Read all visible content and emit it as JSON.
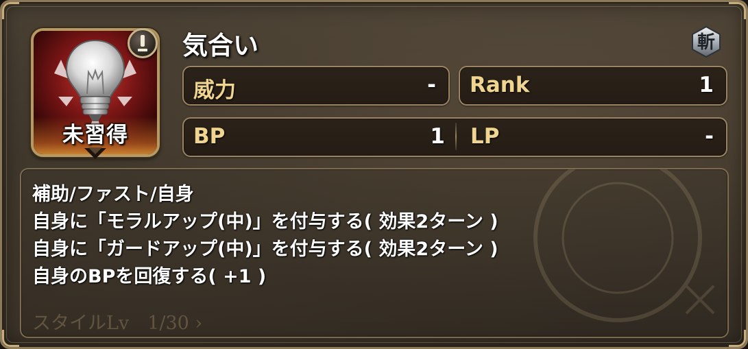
{
  "skill": {
    "name": "気合い",
    "status_label": "未習得",
    "type_badge_glyph": "斬",
    "icon": "lightbulb-icon",
    "alert_icon": "exclamation-icon"
  },
  "stats": {
    "power": {
      "label": "威力",
      "value": "-"
    },
    "rank": {
      "label": "Rank",
      "value": "1"
    },
    "bp": {
      "label": "BP",
      "value": "1"
    },
    "lp": {
      "label": "LP",
      "value": "-"
    }
  },
  "description": {
    "lines": [
      "補助/ファスト/自身",
      "自身に「モラルアップ(中)」を付与する( 効果2ターン )",
      "自身に「ガードアップ(中)」を付与する( 効果2ターン )",
      "自身のBPを回復する( +1 )"
    ]
  },
  "background": {
    "style_level_text": "スタイルLv　1/30 ›"
  },
  "colors": {
    "label_gold": "#efd58f",
    "frame_gold": "#b69a63",
    "icon_red": "#c23a34"
  }
}
